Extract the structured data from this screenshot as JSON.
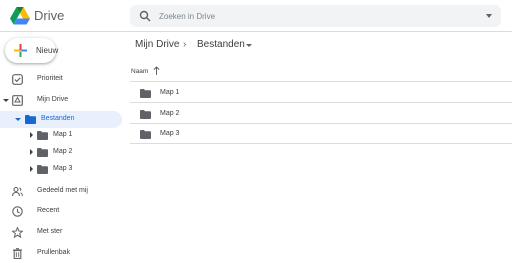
{
  "header": {
    "app_name": "Drive",
    "search_placeholder": "Zoeken in Drive"
  },
  "new_button": {
    "label": "Nieuw"
  },
  "sidebar": {
    "priority": "Prioriteit",
    "my_drive": "Mijn Drive",
    "files_folder": "Bestanden",
    "subfolders": [
      "Map 1",
      "Map 2",
      "Map 3"
    ],
    "shared": "Gedeeld met mij",
    "recent": "Recent",
    "starred": "Met ster",
    "trash": "Prullenbak"
  },
  "breadcrumb": {
    "root": "Mijn Drive",
    "current": "Bestanden"
  },
  "list": {
    "column_name": "Naam",
    "items": [
      "Map 1",
      "Map 2",
      "Map 3"
    ]
  },
  "colors": {
    "accent": "#1967d2",
    "active_bg": "#e8f0fe",
    "icon": "#5f6368",
    "folder": "#5f6368"
  }
}
